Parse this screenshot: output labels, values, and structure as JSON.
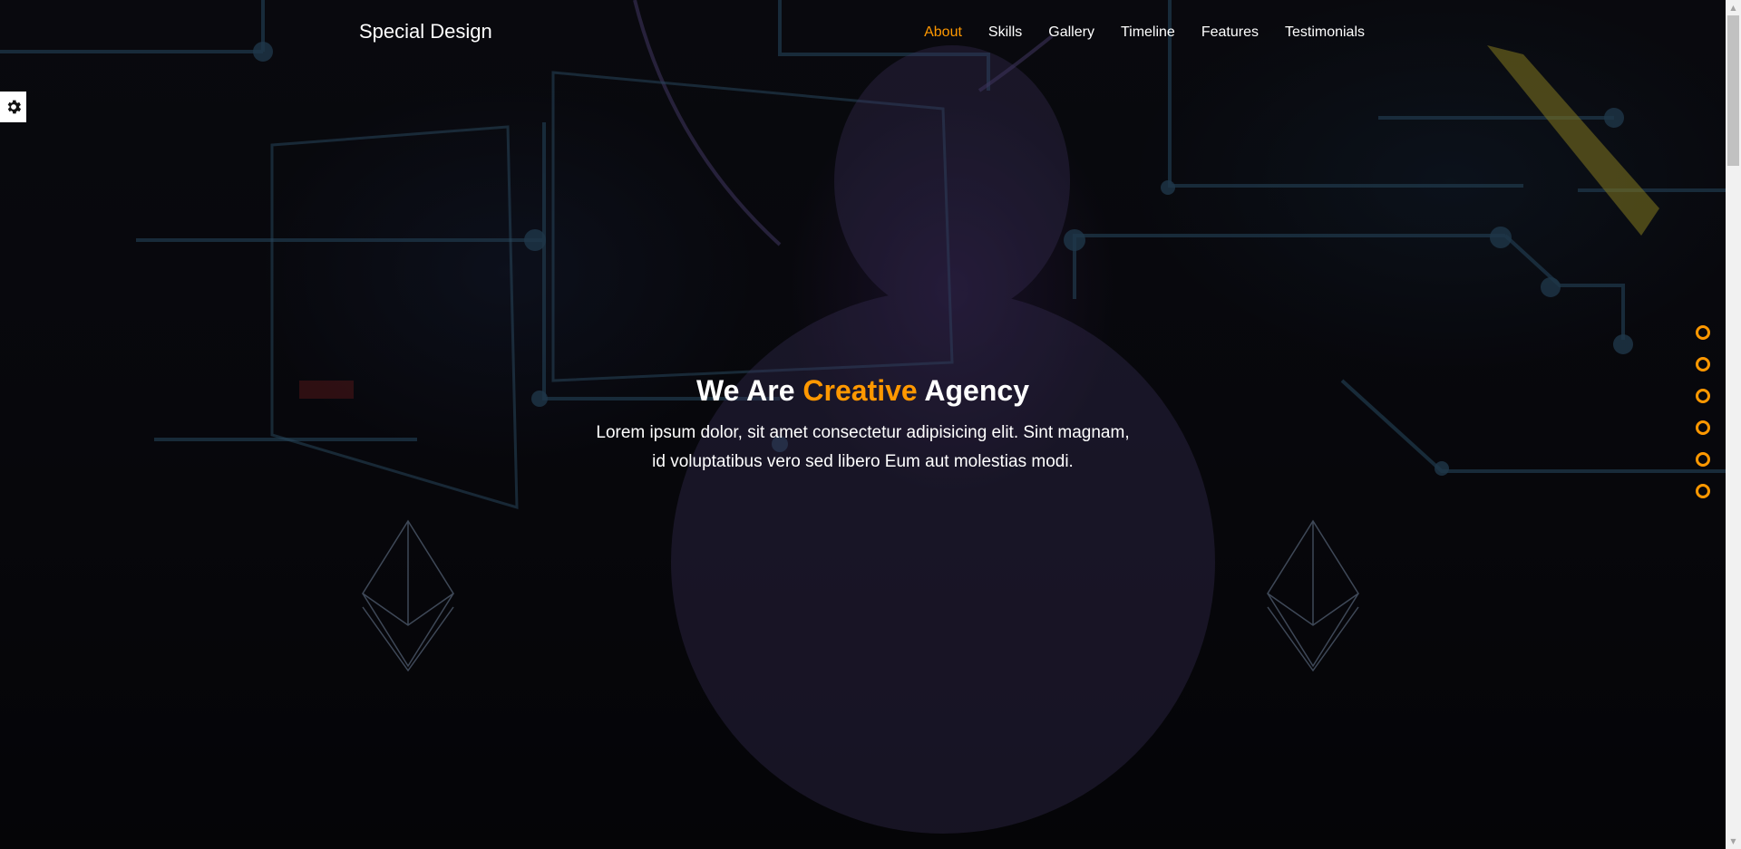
{
  "header": {
    "logo": "Special Design",
    "nav": [
      {
        "label": "About",
        "active": true
      },
      {
        "label": "Skills",
        "active": false
      },
      {
        "label": "Gallery",
        "active": false
      },
      {
        "label": "Timeline",
        "active": false
      },
      {
        "label": "Features",
        "active": false
      },
      {
        "label": "Testimonials",
        "active": false
      }
    ]
  },
  "settings": {
    "icon": "gear-icon"
  },
  "hero": {
    "title_prefix": "We Are ",
    "title_accent": "Creative",
    "title_suffix": " Agency",
    "description": "Lorem ipsum dolor, sit amet consectetur adipisicing elit. Sint magnam, id voluptatibus vero sed libero Eum aut molestias modi."
  },
  "bullets_count": 6,
  "colors": {
    "accent": "#ff9800",
    "text": "#ffffff",
    "background": "#0a0a10"
  }
}
